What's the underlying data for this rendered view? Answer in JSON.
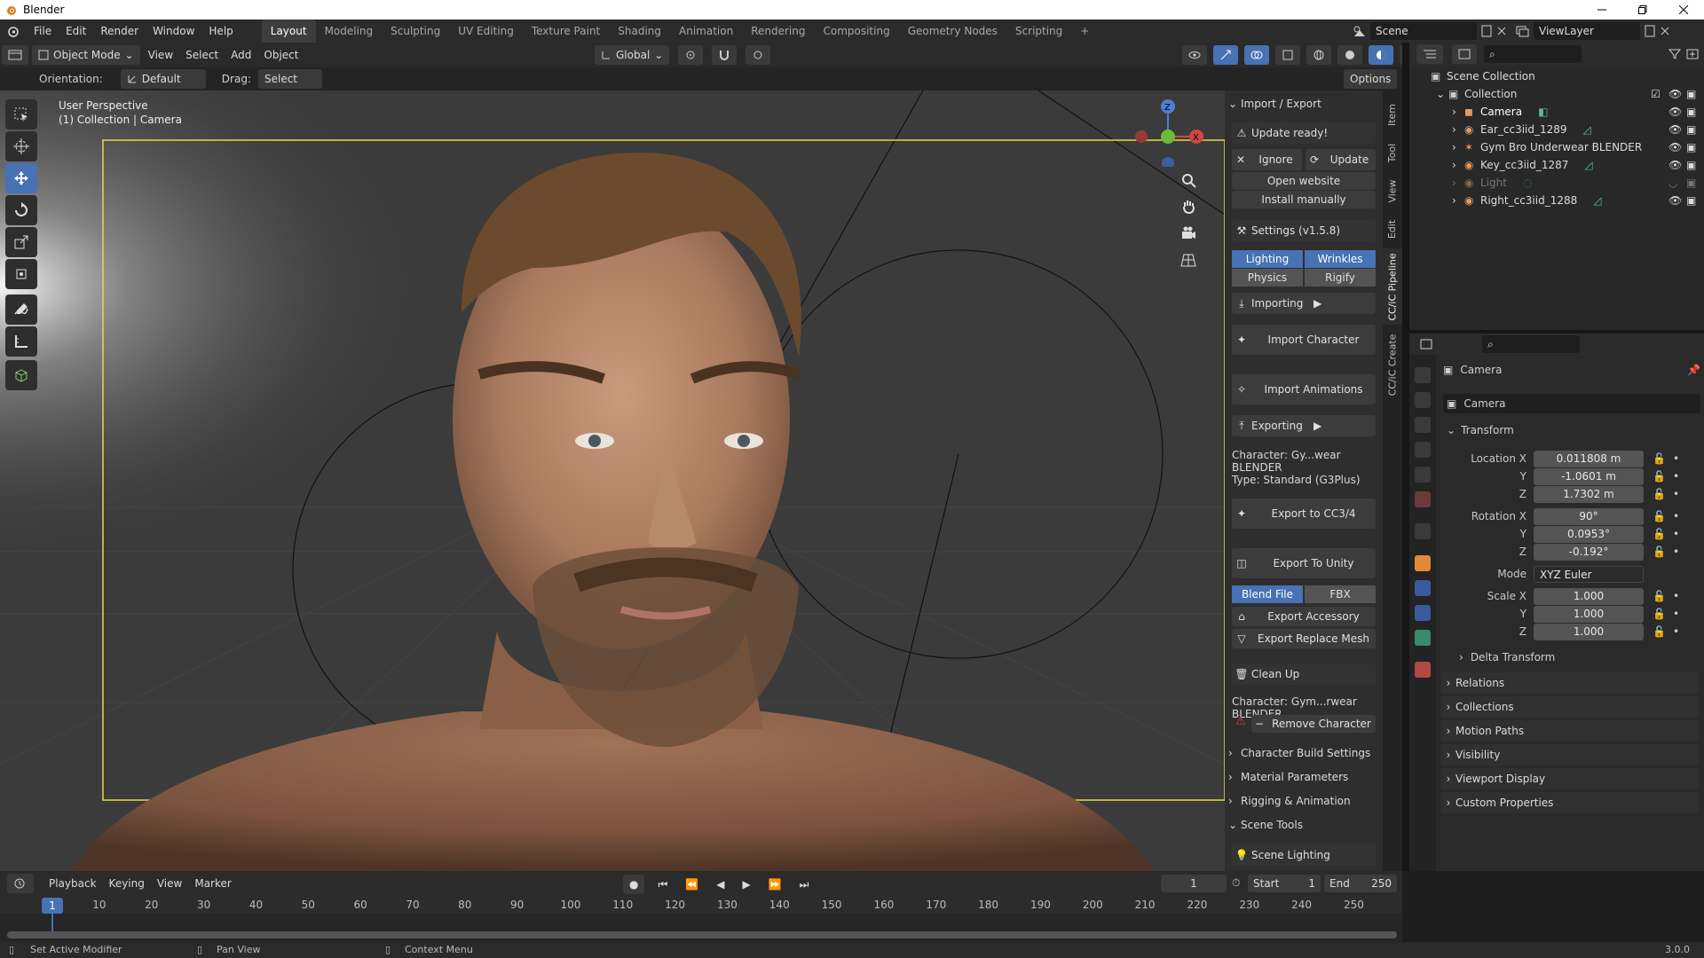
{
  "window": {
    "title": "Blender"
  },
  "menu": [
    "File",
    "Edit",
    "Render",
    "Window",
    "Help"
  ],
  "workspaces": [
    "Layout",
    "Modeling",
    "Sculpting",
    "UV Editing",
    "Texture Paint",
    "Shading",
    "Animation",
    "Rendering",
    "Compositing",
    "Geometry Nodes",
    "Scripting"
  ],
  "scene": {
    "name": "Scene",
    "view_layer": "ViewLayer"
  },
  "viewport_header": {
    "mode": "Object Mode",
    "menus": [
      "View",
      "Select",
      "Add",
      "Object"
    ],
    "transform_orientation": "Global"
  },
  "tool_settings": {
    "orientation_label": "Orientation:",
    "orientation_value": "Default",
    "drag_label": "Drag:",
    "drag_value": "Select Box",
    "options": "Options"
  },
  "viewport": {
    "view_name": "User Perspective",
    "collection_info": "(1) Collection | Camera"
  },
  "npanel": {
    "import_export_title": "Import / Export",
    "update_ready": "Update ready!",
    "ignore": "Ignore",
    "update": "Update",
    "open_website": "Open website",
    "install_manually": "Install manually",
    "settings": "Settings (v1.5.8)",
    "toggles": [
      "Lighting",
      "Wrinkles",
      "Physics",
      "Rigify"
    ],
    "importing": "Importing",
    "import_character": "Import Character",
    "import_animations": "Import Animations",
    "exporting": "Exporting",
    "character_info": "Character: Gy...wear BLENDER",
    "type_info": "Type: Standard (G3Plus)",
    "export_cc": "Export to CC3/4",
    "export_unity": "Export To Unity",
    "unity_modes": [
      "Blend File",
      "FBX"
    ],
    "export_accessory": "Export Accessory",
    "export_replace_mesh": "Export Replace Mesh",
    "clean_up": "Clean Up",
    "cleanup_character": "Character: Gym...rwear BLENDER",
    "remove_character": "Remove Character",
    "sections": [
      "Character Build Settings",
      "Material Parameters",
      "Rigging & Animation"
    ],
    "scene_tools": "Scene Tools",
    "scene_lighting": "Scene Lighting"
  },
  "vertical_tabs": [
    "Item",
    "Tool",
    "View",
    "Edit",
    "CC/iC Pipeline",
    "CC/iC Create"
  ],
  "outliner": {
    "scene_collection": "Scene Collection",
    "collection": "Collection",
    "items": [
      "Camera",
      "Ear_cc3iid_1289",
      "Gym Bro Underwear BLENDER",
      "Key_cc3iid_1287",
      "Light",
      "Right_cc3iid_1288"
    ]
  },
  "properties": {
    "object_name": "Camera",
    "datablock": "Camera",
    "transform": "Transform",
    "location_label": "Location X",
    "location": [
      "0.011808 m",
      "-1.0601 m",
      "1.7302 m"
    ],
    "rotation_label": "Rotation X",
    "rotation": [
      "90°",
      "0.0953°",
      "-0.192°"
    ],
    "axis_y": "Y",
    "axis_z": "Z",
    "mode_label": "Mode",
    "mode": "XYZ Euler",
    "scale_label": "Scale X",
    "scale": [
      "1.000",
      "1.000",
      "1.000"
    ],
    "delta_transform": "Delta Transform",
    "sections": [
      "Relations",
      "Collections",
      "Motion Paths",
      "Visibility",
      "Viewport Display",
      "Custom Properties"
    ]
  },
  "timeline": {
    "menus": [
      "Playback",
      "Keying",
      "View",
      "Marker"
    ],
    "current_frame": "1",
    "start_label": "Start",
    "start": "1",
    "end_label": "End",
    "end": "250",
    "ticks": [
      "1",
      "10",
      "20",
      "30",
      "40",
      "50",
      "60",
      "70",
      "80",
      "90",
      "100",
      "110",
      "120",
      "130",
      "140",
      "150",
      "160",
      "170",
      "180",
      "190",
      "200",
      "210",
      "220",
      "230",
      "240",
      "250"
    ]
  },
  "statusbar": {
    "left": "Set Active Modifier",
    "middle": "Pan View",
    "right": "Context Menu",
    "version": "3.0.0"
  },
  "colors": {
    "accent": "#4772b3",
    "active_outline": "#f5d94a",
    "header": "#2b2b2b",
    "panel": "#2e2e2e"
  }
}
